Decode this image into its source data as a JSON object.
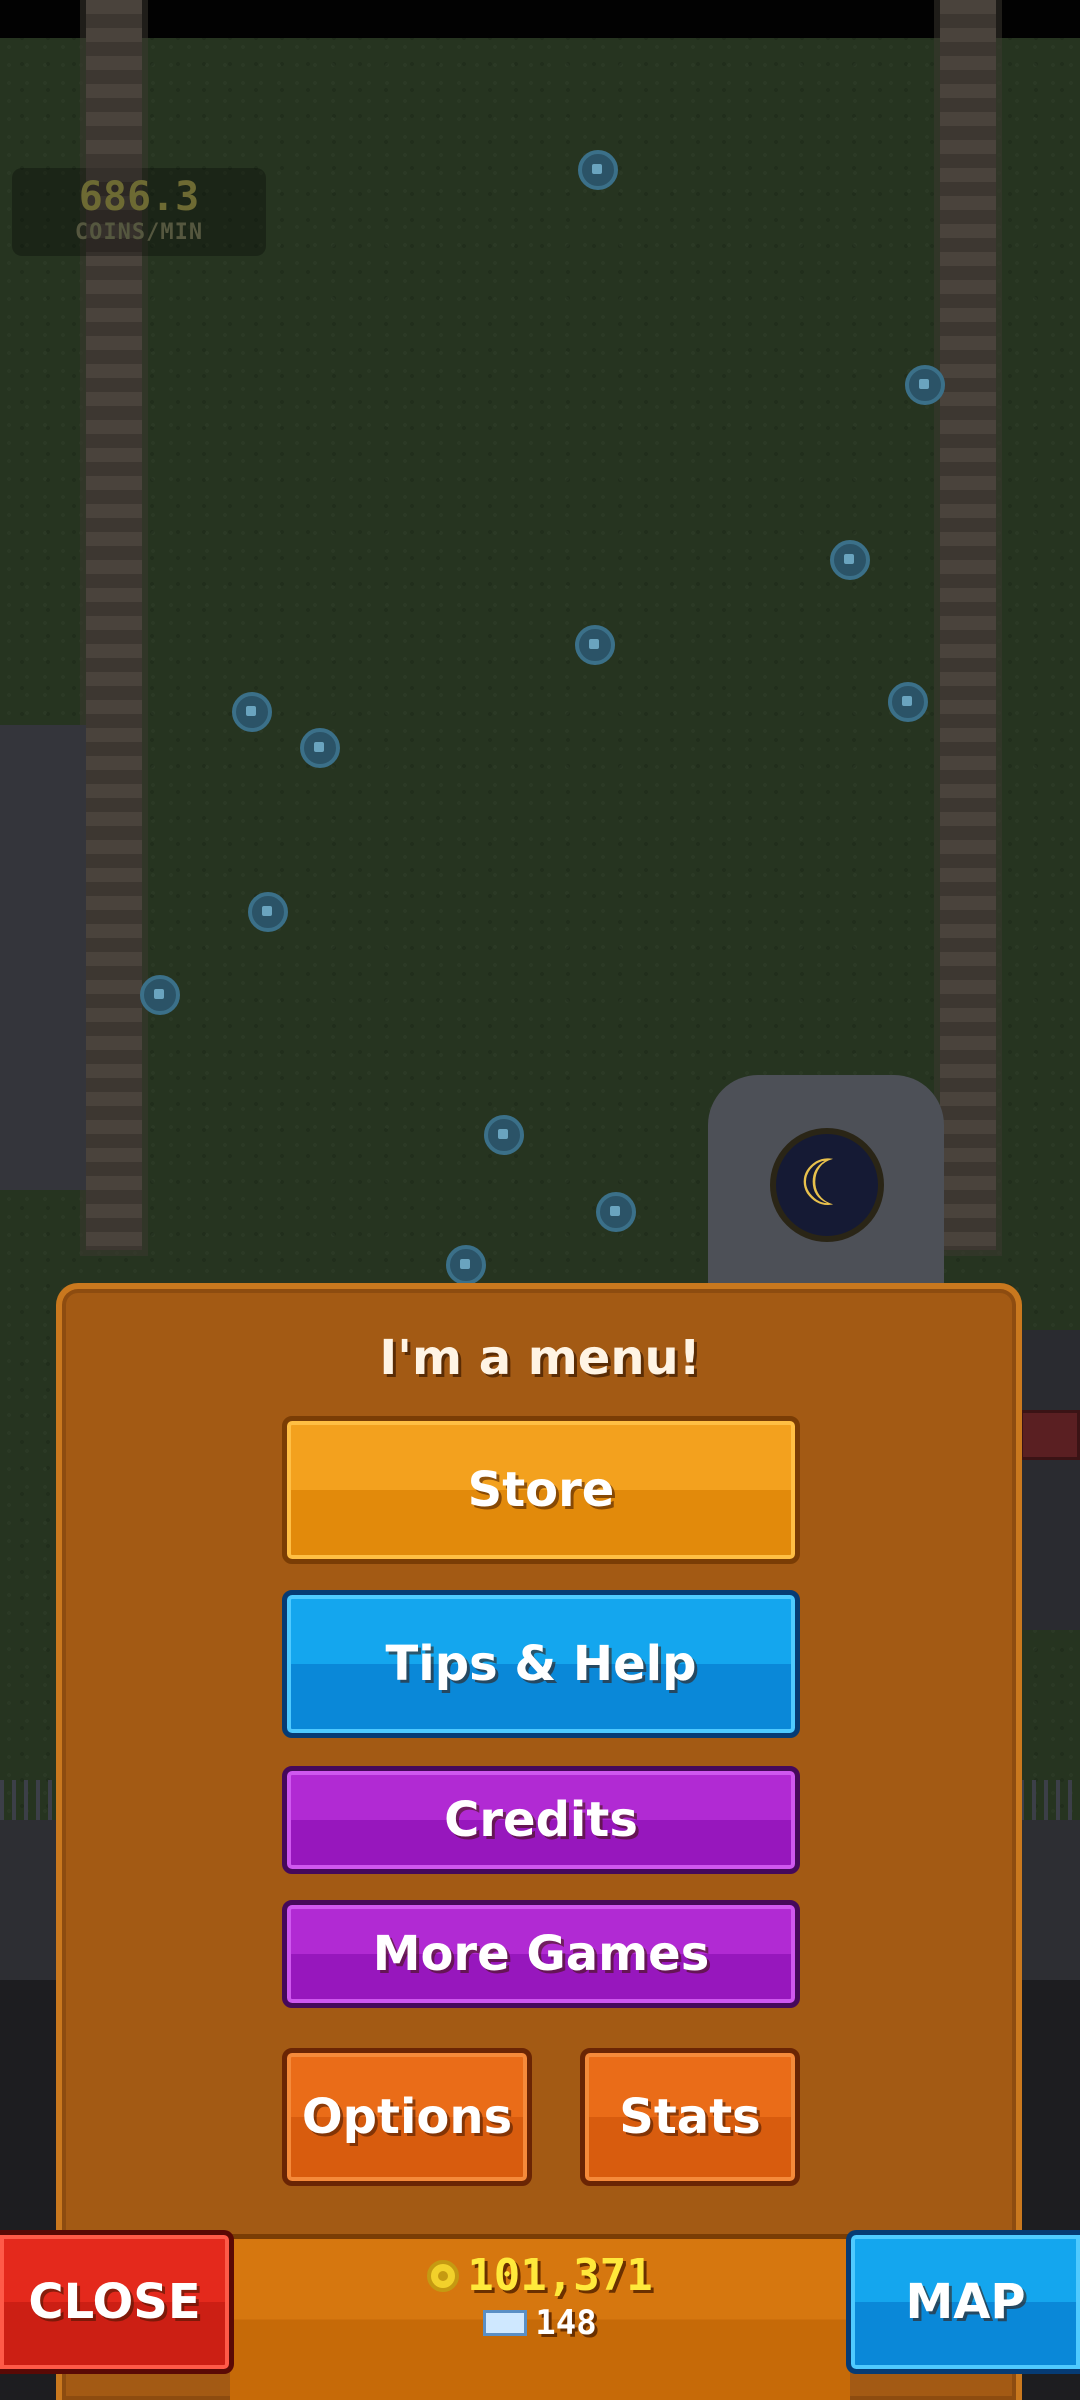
{
  "hud": {
    "coins_per_min_value": "686.3",
    "coins_per_min_label": "COINS/MIN"
  },
  "menu": {
    "title": "I'm a menu!",
    "buttons": {
      "store": "Store",
      "tips_help": "Tips & Help",
      "credits": "Credits",
      "more_games": "More Games",
      "options": "Options",
      "stats": "Stats"
    }
  },
  "bottom_bar": {
    "close_label": "CLOSE",
    "map_label": "MAP",
    "coins": "101,371",
    "tickets": "148",
    "coin_icon": "coin-icon",
    "ticket_icon": "ticket-icon"
  },
  "colors": {
    "menu_panel": "#a35a14",
    "store": "#f3a11e",
    "tips": "#14a6ee",
    "credits": "#b12ad3",
    "options": "#ea6c18",
    "close": "#e4291c",
    "coin_text": "#ffe93b"
  }
}
